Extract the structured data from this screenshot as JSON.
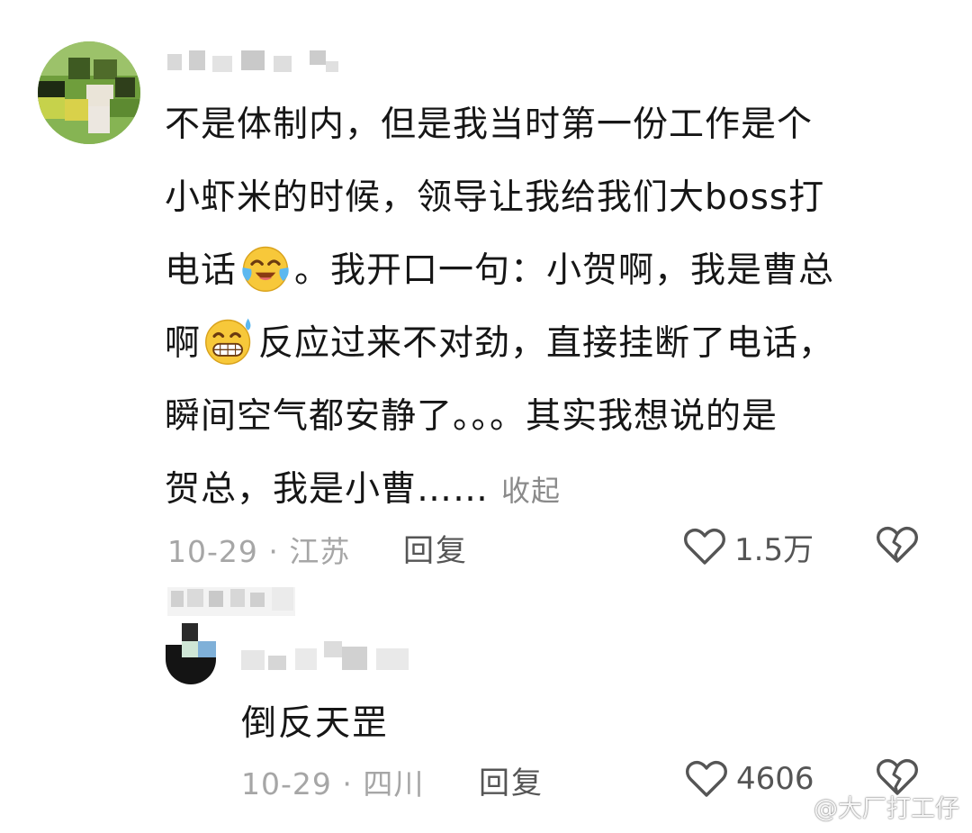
{
  "comment": {
    "text_lines": [
      "不是体制内，但是我当时第一份工作是个",
      "小虾米的时候，领导让我给我们大boss打",
      "电话",
      "。我开口一句：小贺啊，我是曹总",
      "啊",
      "反应过来不对劲，直接挂断了电话，",
      "瞬间空气都安静了。。。其实我想说的是",
      "贺总，我是小曹……"
    ],
    "collapse_label": "收起",
    "date_location": "10-29 · 江苏",
    "reply_label": "回复",
    "like_count": "1.5万",
    "emojis": [
      "crying-laughing-emoji",
      "sweat-grin-emoji"
    ]
  },
  "reply": {
    "text": "倒反天罡",
    "date_location": "10-29 · 四川",
    "reply_label": "回复",
    "like_count": "4606"
  },
  "watermark": {
    "text": "@大厂打工仔"
  },
  "colors": {
    "text_primary": "#161616",
    "text_meta": "#a6a6a6",
    "text_action": "#555555",
    "emoji_face": "#f7c83a"
  }
}
